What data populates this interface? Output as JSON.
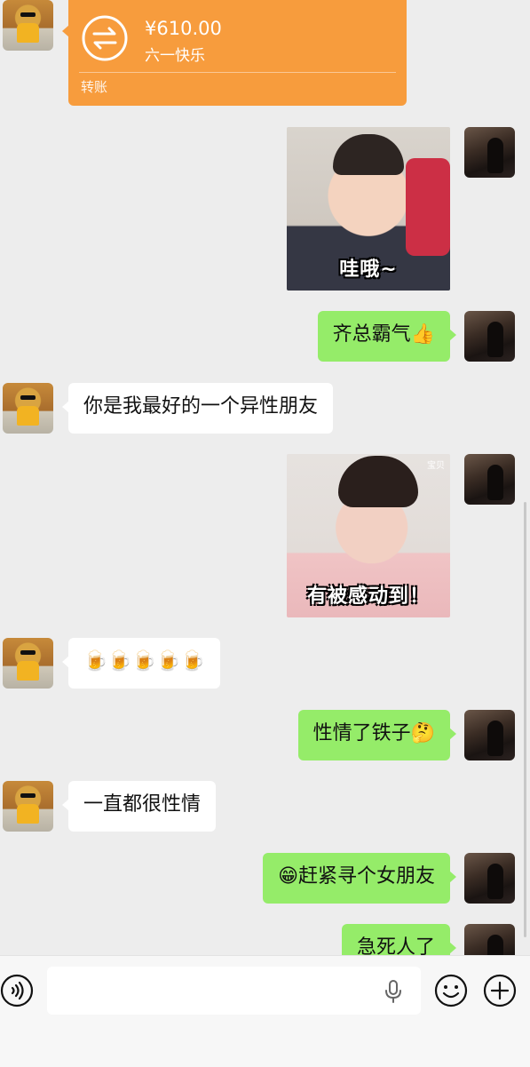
{
  "transfer": {
    "amount": "¥610.00",
    "memo": "六一快乐",
    "type_label": "转账",
    "color": "#f79c3d"
  },
  "stickers": [
    {
      "caption": "哇哦~",
      "watermark": ""
    },
    {
      "caption": "有被感动到！",
      "watermark": "宝贝"
    }
  ],
  "messages": [
    {
      "from": "me",
      "text": "齐总霸气👍"
    },
    {
      "from": "friend",
      "text": "你是我最好的一个异性朋友"
    },
    {
      "from": "friend",
      "text": "🍺🍺🍺🍺🍺"
    },
    {
      "from": "me",
      "text": "性情了铁子🤔"
    },
    {
      "from": "friend",
      "text": "一直都很性情"
    },
    {
      "from": "me",
      "text": "😁赶紧寻个女朋友"
    },
    {
      "from": "me",
      "text": "急死人了"
    }
  ],
  "input": {
    "value": "",
    "placeholder": ""
  },
  "icons": {
    "voice": "voice-icon",
    "mic": "mic-icon",
    "emoji": "emoji-icon",
    "plus": "plus-icon",
    "transfer": "transfer-arrows-icon"
  },
  "colors": {
    "background": "#ededed",
    "outgoing_bubble": "#95ec69",
    "incoming_bubble": "#ffffff"
  }
}
